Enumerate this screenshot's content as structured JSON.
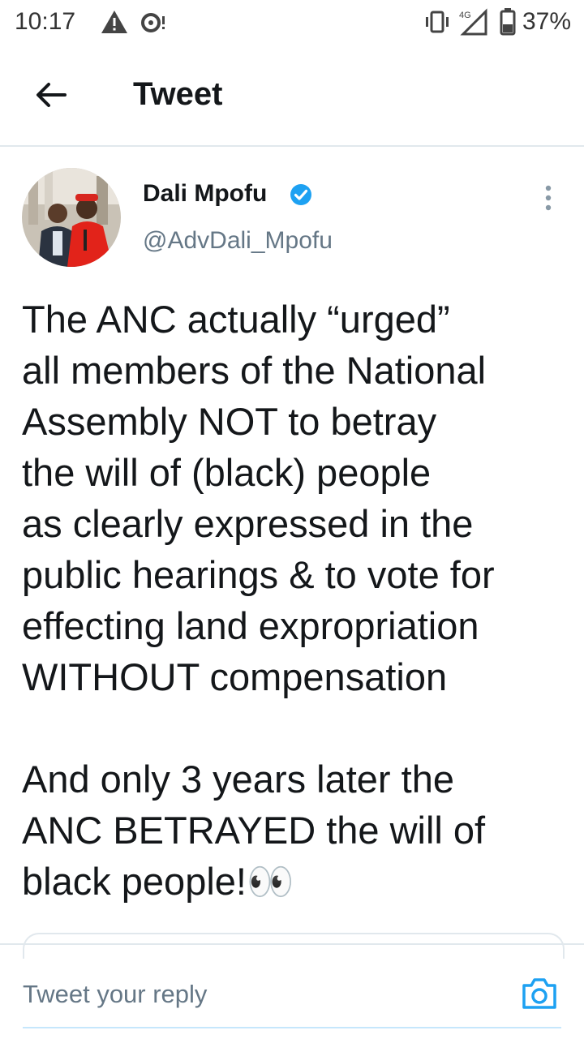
{
  "status_bar": {
    "time": "10:17",
    "network": "4G",
    "battery": "37%"
  },
  "header": {
    "title": "Tweet"
  },
  "tweet": {
    "author_name": "Dali Mpofu",
    "handle": "@AdvDali_Mpofu",
    "verified": true,
    "text": "The ANC actually “urged”\nall members of the National\nAssembly NOT to betray\nthe will of (black) people\nas clearly expressed in the\npublic hearings & to vote for\neffecting land expropriation\nWITHOUT compensation\n\nAnd only 3 years later the\nANC BETRAYED the will of\nblack people!👀"
  },
  "reply": {
    "placeholder": "Tweet your reply"
  },
  "colors": {
    "accent": "#1da1f2",
    "text": "#14171a",
    "secondary": "#657786",
    "divider": "#e1e8ed"
  },
  "icons": {
    "back": "arrow-left-icon",
    "verified": "verified-badge-icon",
    "more": "more-vertical-icon",
    "camera": "camera-icon"
  }
}
